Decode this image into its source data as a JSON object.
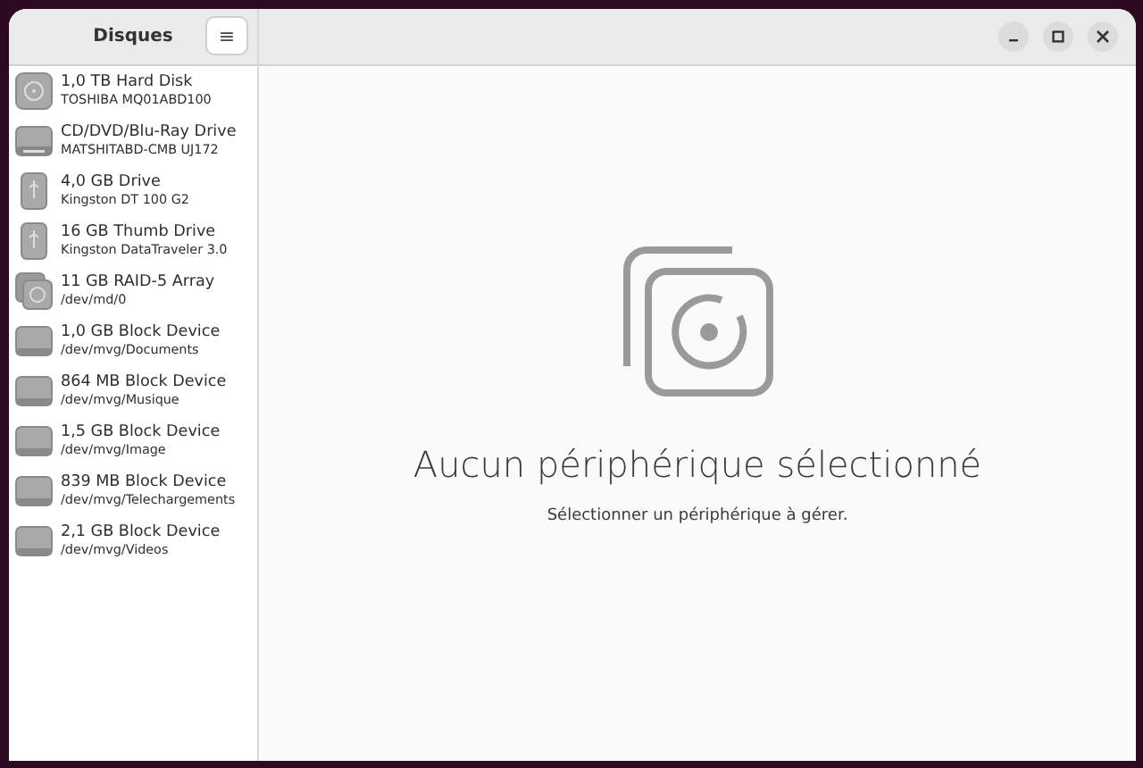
{
  "sidebar": {
    "title": "Disques",
    "menu_button": "≡",
    "devices": [
      {
        "kind": "hdd",
        "name": "1,0 TB Hard Disk",
        "detail": "TOSHIBA MQ01ABD100"
      },
      {
        "kind": "optical",
        "name": "CD/DVD/Blu-Ray Drive",
        "detail": "MATSHITABD-CMB UJ172"
      },
      {
        "kind": "usb",
        "name": "4,0 GB Drive",
        "detail": "Kingston DT 100 G2"
      },
      {
        "kind": "usb",
        "name": "16 GB Thumb Drive",
        "detail": "Kingston DataTraveler 3.0"
      },
      {
        "kind": "raid",
        "name": "11 GB RAID-5 Array",
        "detail": "/dev/md/0"
      },
      {
        "kind": "block",
        "name": "1,0 GB Block Device",
        "detail": "/dev/mvg/Documents"
      },
      {
        "kind": "block",
        "name": "864 MB Block Device",
        "detail": "/dev/mvg/Musique"
      },
      {
        "kind": "block",
        "name": "1,5 GB Block Device",
        "detail": "/dev/mvg/Image"
      },
      {
        "kind": "block",
        "name": "839 MB Block Device",
        "detail": "/dev/mvg/Telechargements"
      },
      {
        "kind": "block",
        "name": "2,1 GB Block Device",
        "detail": "/dev/mvg/Videos"
      }
    ]
  },
  "main": {
    "heading": "Aucun périphérique sélectionné",
    "subtext": "Sélectionner un périphérique à gérer."
  }
}
